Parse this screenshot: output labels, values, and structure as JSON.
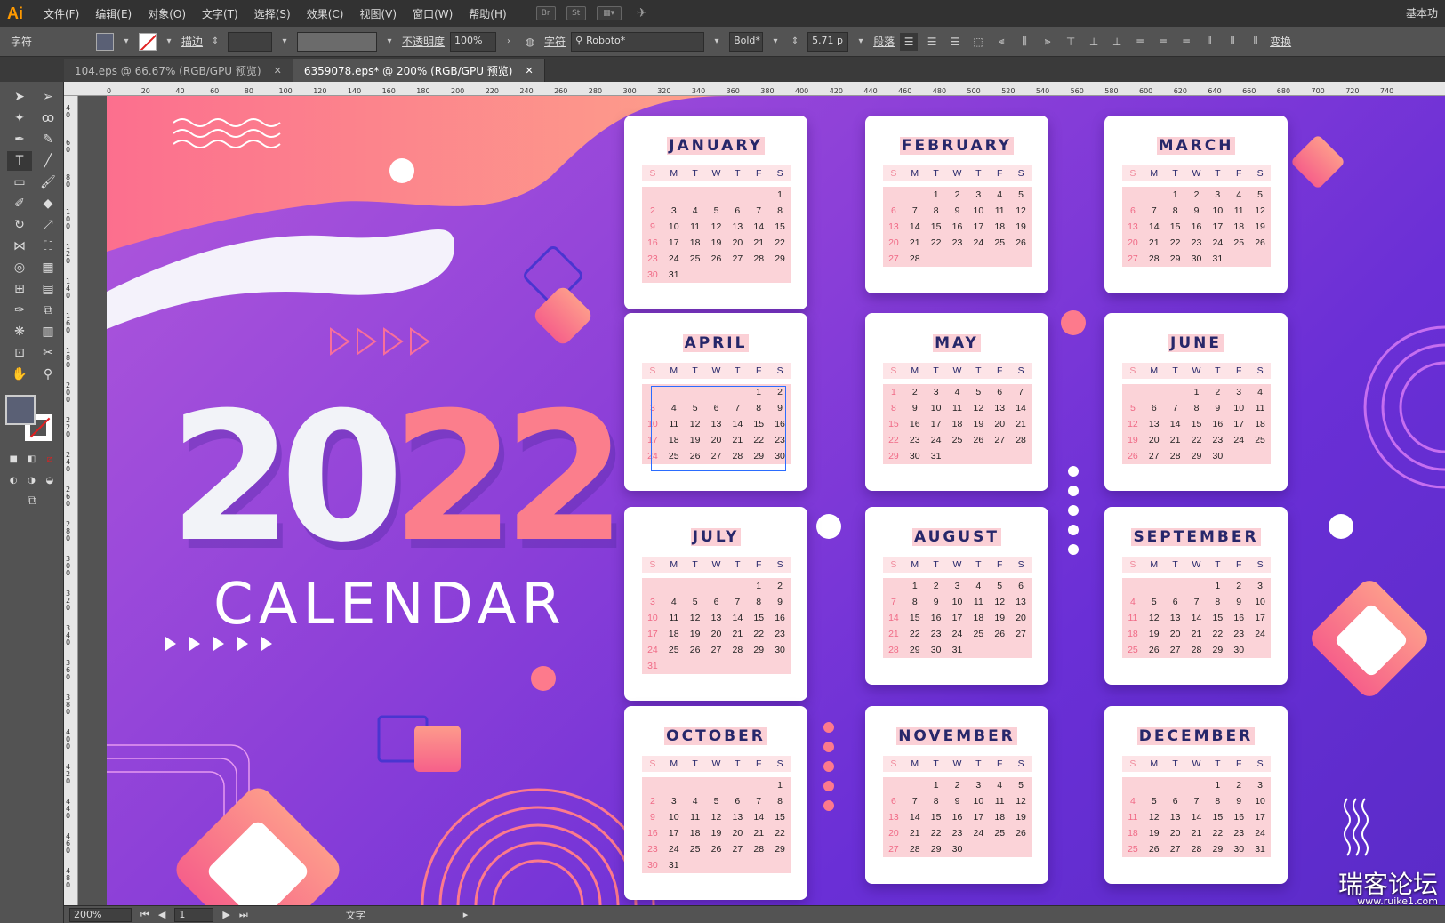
{
  "app": {
    "logo": "Ai",
    "workspace": "基本功"
  },
  "menu": [
    "文件(F)",
    "编辑(E)",
    "对象(O)",
    "文字(T)",
    "选择(S)",
    "效果(C)",
    "视图(V)",
    "窗口(W)",
    "帮助(H)"
  ],
  "menu_icons": [
    "Br",
    "St"
  ],
  "control": {
    "panel_label": "字符",
    "stroke_label": "描边",
    "opacity_label": "不透明度",
    "opacity_value": "100%",
    "char_label": "字符",
    "font_name": "Roboto*",
    "font_style": "Bold*",
    "font_size": "5.71 p",
    "para_label": "段落",
    "transform_label": "变换"
  },
  "tabs": [
    {
      "label": "104.eps @ 66.67% (RGB/GPU 预览)",
      "active": false
    },
    {
      "label": "6359078.eps* @ 200% (RGB/GPU 预览)",
      "active": true
    }
  ],
  "ruler_top": [
    "0",
    "20",
    "40",
    "60",
    "80",
    "100",
    "120",
    "140",
    "160",
    "180",
    "200",
    "220",
    "240",
    "260",
    "280",
    "300",
    "320",
    "340",
    "360",
    "380",
    "400",
    "420",
    "440",
    "460",
    "480",
    "500",
    "520",
    "540",
    "560",
    "580",
    "600",
    "620",
    "640",
    "660",
    "680",
    "700",
    "720",
    "740"
  ],
  "ruler_left": [
    "40",
    "60",
    "80",
    "100",
    "120",
    "140",
    "160",
    "180",
    "200",
    "220",
    "240",
    "260",
    "280",
    "300",
    "320",
    "340",
    "360",
    "380",
    "400",
    "420",
    "440",
    "460",
    "480"
  ],
  "status": {
    "zoom": "200%",
    "page": "1",
    "tool": "文字"
  },
  "artwork": {
    "year_part1": "20",
    "year_part2": "2",
    "year_part3": "2",
    "title": "CALENDAR"
  },
  "calendar": {
    "weekday_headers": [
      "S",
      "M",
      "T",
      "W",
      "T",
      "F",
      "S"
    ],
    "months": [
      {
        "name": "JANUARY",
        "start": 6,
        "days": 31
      },
      {
        "name": "FEBRUARY",
        "start": 2,
        "days": 28
      },
      {
        "name": "MARCH",
        "start": 2,
        "days": 31
      },
      {
        "name": "APRIL",
        "start": 5,
        "days": 30
      },
      {
        "name": "MAY",
        "start": 0,
        "days": 31
      },
      {
        "name": "JUNE",
        "start": 3,
        "days": 30
      },
      {
        "name": "JULY",
        "start": 5,
        "days": 31
      },
      {
        "name": "AUGUST",
        "start": 1,
        "days": 31
      },
      {
        "name": "SEPTEMBER",
        "start": 4,
        "days": 30
      },
      {
        "name": "OCTOBER",
        "start": 6,
        "days": 31
      },
      {
        "name": "NOVEMBER",
        "start": 2,
        "days": 30
      },
      {
        "name": "DECEMBER",
        "start": 4,
        "days": 31
      }
    ]
  },
  "watermark": {
    "title": "瑞客论坛",
    "url": "www.ruike1.com"
  },
  "colors": {
    "accent_pink": "#fb7e8c",
    "navy": "#27276a",
    "purple": "#7a35d8"
  }
}
